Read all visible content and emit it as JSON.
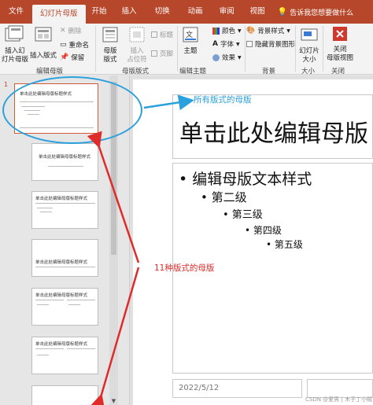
{
  "tabs": [
    {
      "label": "文件",
      "active": false
    },
    {
      "label": "幻灯片母版",
      "active": true
    },
    {
      "label": "开始",
      "active": false
    },
    {
      "label": "插入",
      "active": false
    },
    {
      "label": "切换",
      "active": false
    },
    {
      "label": "动画",
      "active": false
    },
    {
      "label": "审阅",
      "active": false
    },
    {
      "label": "视图",
      "active": false
    }
  ],
  "tell_me": "告诉我您想要做什么",
  "ribbon": {
    "insert_slide_master": "插入幻灯片母版",
    "insert_slide_master_l1": "插入幻",
    "insert_slide_master_l2": "灯片母版",
    "insert_layout": "插入版式",
    "delete": "删除",
    "rename": "重命名",
    "preserve": "保留",
    "master_layout_l1": "母版",
    "master_layout_l2": "版式",
    "insert_placeholder_l1": "插入",
    "insert_placeholder_l2": "占位符",
    "title_check": "标题",
    "footer_check": "页脚",
    "themes": "主题",
    "colors": "颜色",
    "fonts": "字体",
    "effects": "效果",
    "background_styles": "背景样式",
    "hide_background": "隐藏背景图形",
    "slide_size_l1": "幻灯片",
    "slide_size_l2": "大小",
    "close_l1": "关闭",
    "close_l2": "母版视图",
    "groups": {
      "edit_master": "编辑母版",
      "master_layout": "母版版式",
      "edit_theme": "编辑主题",
      "background": "背景",
      "size": "大小",
      "close": "关闭"
    }
  },
  "thumbnails": {
    "slide_number": "1",
    "t1": "单击此处编辑母版标题样式",
    "t2": "单击此处编辑母版标题样式",
    "t3": "单击此处编辑母版标题样式",
    "t4": "单击此处编辑母版标题样式",
    "t5": "单击此处编辑母版标题样式",
    "t6": "单击此处编辑母版标题样式"
  },
  "slide": {
    "title": "单击此处编辑母版",
    "bullets": [
      {
        "text": "• 编辑母版文本样式",
        "level": 1
      },
      {
        "text": "• 第二级",
        "level": 2
      },
      {
        "text": "• 第三级",
        "level": 3
      },
      {
        "text": "• 第四级",
        "level": 4
      },
      {
        "text": "• 第五级",
        "level": 5
      }
    ],
    "date": "2022/5/12"
  },
  "annotations": {
    "master_label": "所有版式的母版",
    "layouts_label": "11种版式的母版",
    "colors": {
      "blue": "#2aa0dc",
      "red": "#e02b2b"
    }
  },
  "watermark": "CSDN @爱男 | 木子丁小贼"
}
